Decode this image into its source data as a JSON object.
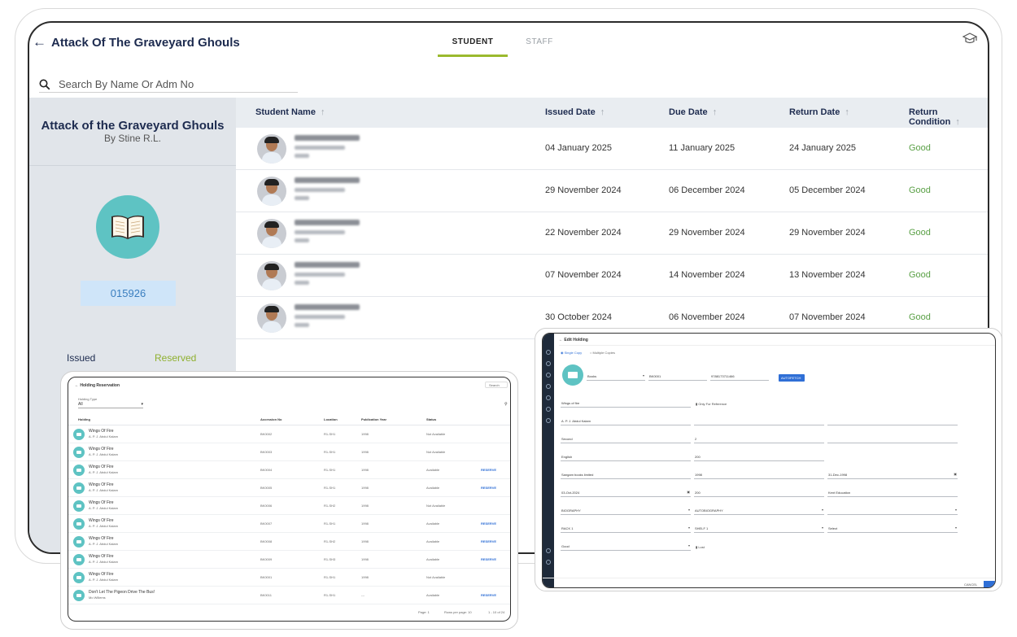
{
  "header": {
    "title": "Attack Of The Graveyard Ghouls"
  },
  "tabs": [
    {
      "label": "STUDENT",
      "active": true
    },
    {
      "label": "STAFF",
      "active": false
    }
  ],
  "search": {
    "placeholder": "Search By Name Or Adm No"
  },
  "book": {
    "title": "Attack of the Graveyard Ghouls",
    "author": "By Stine R.L.",
    "accession": "015926",
    "issued_label": "Issued",
    "reserved_label": "Reserved"
  },
  "table": {
    "headers": [
      "Student Name",
      "Issued Date",
      "Due Date",
      "Return Date",
      "Return Condition"
    ],
    "rows": [
      {
        "issued": "04 January 2025",
        "due": "11 January 2025",
        "returned": "24 January 2025",
        "condition": "Good"
      },
      {
        "issued": "29 November 2024",
        "due": "06 December 2024",
        "returned": "05 December 2024",
        "condition": "Good"
      },
      {
        "issued": "22 November 2024",
        "due": "29 November 2024",
        "returned": "29 November 2024",
        "condition": "Good"
      },
      {
        "issued": "07 November 2024",
        "due": "14 November 2024",
        "returned": "13 November 2024",
        "condition": "Good"
      },
      {
        "issued": "30 October 2024",
        "due": "06 November 2024",
        "returned": "07 November 2024",
        "condition": "Good"
      }
    ]
  },
  "reservation": {
    "title": "Holding Reservation",
    "search_placeholder": "Search",
    "type_label": "Holding Type",
    "type_value": "All",
    "headers": [
      "Holding",
      "Accession No",
      "Location",
      "Publication Year",
      "Status"
    ],
    "rows": [
      {
        "title": "Wings Of Fire",
        "author": "A. P. J. Abdul Kalam",
        "acc": "BK0002",
        "loc": "R1-SH1",
        "year": "1998",
        "status": "Not Available",
        "action": ""
      },
      {
        "title": "Wings Of Fire",
        "author": "A. P. J. Abdul Kalam",
        "acc": "BK0003",
        "loc": "R1-SH1",
        "year": "1998",
        "status": "Not Available",
        "action": ""
      },
      {
        "title": "Wings Of Fire",
        "author": "A. P. J. Abdul Kalam",
        "acc": "BK0004",
        "loc": "R1-SH1",
        "year": "1998",
        "status": "Available",
        "action": "RESERVE"
      },
      {
        "title": "Wings Of Fire",
        "author": "A. P. J. Abdul Kalam",
        "acc": "BK0005",
        "loc": "R1-SH1",
        "year": "1998",
        "status": "Available",
        "action": "RESERVE"
      },
      {
        "title": "Wings Of Fire",
        "author": "A. P. J. Abdul Kalam",
        "acc": "BK0006",
        "loc": "R1-SH2",
        "year": "1998",
        "status": "Not Available",
        "action": ""
      },
      {
        "title": "Wings Of Fire",
        "author": "A. P. J. Abdul Kalam",
        "acc": "BK0007",
        "loc": "R1-SH1",
        "year": "1998",
        "status": "Available",
        "action": "RESERVE"
      },
      {
        "title": "Wings Of Fire",
        "author": "A. P. J. Abdul Kalam",
        "acc": "BK0008",
        "loc": "R1-SH2",
        "year": "1998",
        "status": "Available",
        "action": "RESERVE"
      },
      {
        "title": "Wings Of Fire",
        "author": "A. P. J. Abdul Kalam",
        "acc": "BK0009",
        "loc": "R1-SH3",
        "year": "1998",
        "status": "Available",
        "action": "RESERVE"
      },
      {
        "title": "Wings Of Fire",
        "author": "A. P. J. Abdul Kalam",
        "acc": "BK0001",
        "loc": "R1-SH1",
        "year": "1998",
        "status": "Not Available",
        "action": ""
      },
      {
        "title": "Don't Let The Pigeon Drive The Bus!",
        "author": "Mo Willems",
        "acc": "BK0011",
        "loc": "R1-SH1",
        "year": "---",
        "status": "Available",
        "action": "RESERVE"
      }
    ],
    "pager_page": "Page: 1",
    "pager_rows": "Rows per page: 10",
    "pager_range": "1 - 10 of 24"
  },
  "edit": {
    "title": "Edit Holding",
    "mode_single": "Single Copy",
    "mode_multiple": "Multiple Copies",
    "holding_type": "Books",
    "accession": "BK0001",
    "isbn": "9788173711466",
    "autofetch": "AUTOFETCH",
    "title_value": "Wings of fire",
    "only_ref": "Only For Reference",
    "author": "A. P. J. Abdul Kalam",
    "edition": "Second",
    "volume": "2",
    "language": "English",
    "pages": "200",
    "publisher": "Sangam books limited",
    "pub_year": "1998",
    "date_of_purchase": "31-Dec-1998",
    "purchase_date": "03-Oct-2024",
    "cost": "200",
    "vendor": "Kent Education",
    "type": "BIOGRAPHY",
    "category": "AUTOBIOGRAPHY",
    "rack": "RACK 1",
    "shelf": "SHELF 1",
    "sub_select": "Select",
    "condition": "Good",
    "lost": "Lost",
    "cancel": "CANCEL"
  }
}
